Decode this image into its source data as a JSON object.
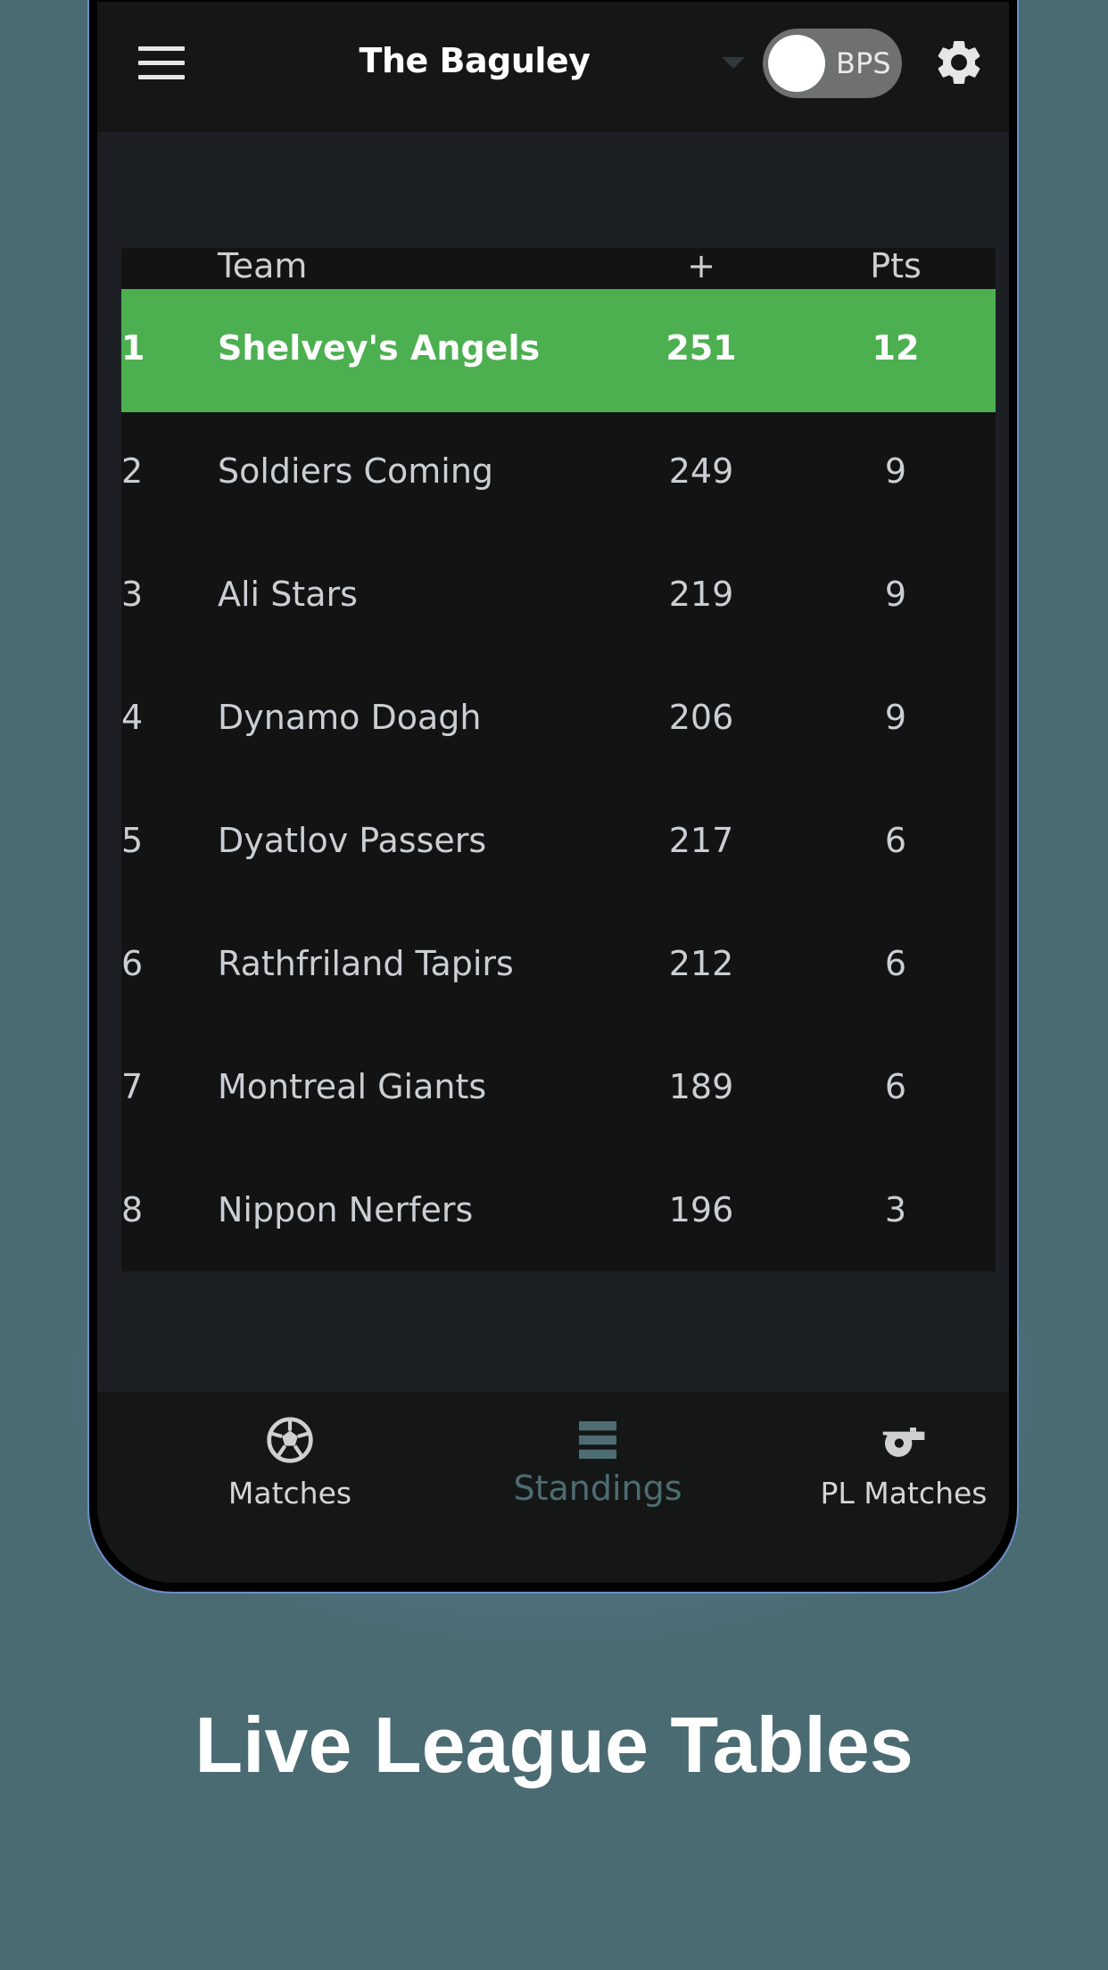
{
  "header": {
    "title": "The Baguley",
    "toggle_label": "BPS"
  },
  "standings": {
    "columns": {
      "team": "Team",
      "plus": "+",
      "pts": "Pts"
    },
    "rows": [
      {
        "rank": "1",
        "team": "Shelvey's Angels",
        "plus": "251",
        "pts": "12"
      },
      {
        "rank": "2",
        "team": "Soldiers Coming",
        "plus": "249",
        "pts": "9"
      },
      {
        "rank": "3",
        "team": "Ali Stars",
        "plus": "219",
        "pts": "9"
      },
      {
        "rank": "4",
        "team": "Dynamo Doagh",
        "plus": "206",
        "pts": "9"
      },
      {
        "rank": "5",
        "team": "Dyatlov Passers",
        "plus": "217",
        "pts": "6"
      },
      {
        "rank": "6",
        "team": "Rathfriland Tapirs",
        "plus": "212",
        "pts": "6"
      },
      {
        "rank": "7",
        "team": "Montreal Giants",
        "plus": "189",
        "pts": "6"
      },
      {
        "rank": "8",
        "team": "Nippon Nerfers",
        "plus": "196",
        "pts": "3"
      }
    ]
  },
  "bottom_nav": {
    "matches": "Matches",
    "standings": "Standings",
    "pl_matches": "PL Matches"
  },
  "caption": "Live League Tables",
  "colors": {
    "leader_row": "#4caf50",
    "active_tab": "#4d6d72",
    "background": "#4b6b72"
  }
}
